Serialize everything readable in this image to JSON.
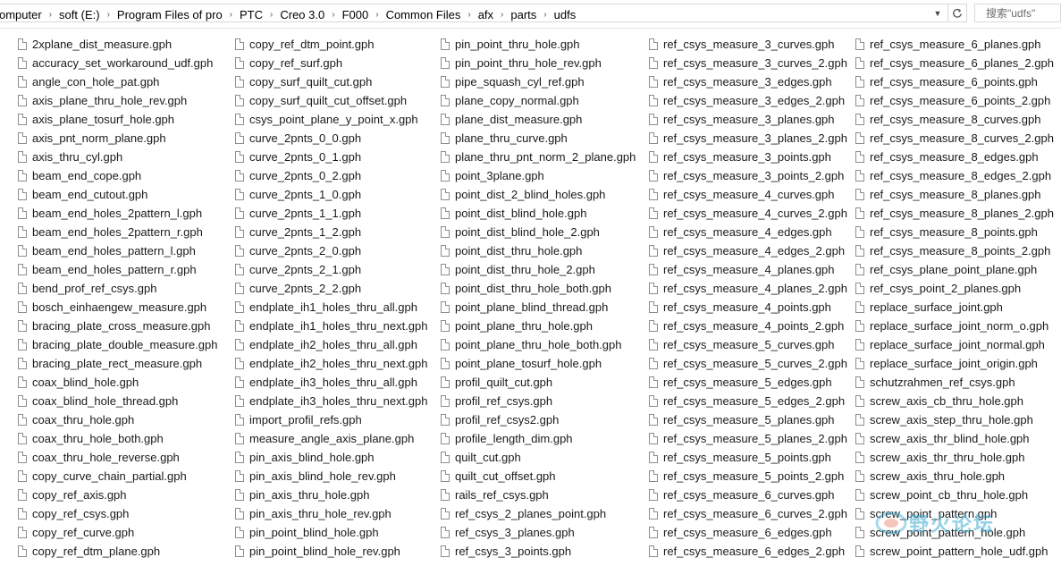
{
  "address_bar": {
    "crumbs": [
      "omputer",
      "soft (E:)",
      "Program Files of pro",
      "PTC",
      "Creo 3.0",
      "F000",
      "Common Files",
      "afx",
      "parts",
      "udfs"
    ]
  },
  "search": {
    "placeholder": "搜索\"udfs\""
  },
  "watermark": {
    "text": "野火论坛"
  },
  "files": [
    [
      "2xplane_dist_measure.gph",
      "accuracy_set_workaround_udf.gph",
      "angle_con_hole_pat.gph",
      "axis_plane_thru_hole_rev.gph",
      "axis_plane_tosurf_hole.gph",
      "axis_pnt_norm_plane.gph",
      "axis_thru_cyl.gph",
      "beam_end_cope.gph",
      "beam_end_cutout.gph",
      "beam_end_holes_2pattern_l.gph",
      "beam_end_holes_2pattern_r.gph",
      "beam_end_holes_pattern_l.gph",
      "beam_end_holes_pattern_r.gph",
      "bend_prof_ref_csys.gph",
      "bosch_einhaengew_measure.gph",
      "bracing_plate_cross_measure.gph",
      "bracing_plate_double_measure.gph",
      "bracing_plate_rect_measure.gph",
      "coax_blind_hole.gph",
      "coax_blind_hole_thread.gph",
      "coax_thru_hole.gph",
      "coax_thru_hole_both.gph",
      "coax_thru_hole_reverse.gph",
      "copy_curve_chain_partial.gph",
      "copy_ref_axis.gph",
      "copy_ref_csys.gph",
      "copy_ref_curve.gph",
      "copy_ref_dtm_plane.gph"
    ],
    [
      "copy_ref_dtm_point.gph",
      "copy_ref_surf.gph",
      "copy_surf_quilt_cut.gph",
      "copy_surf_quilt_cut_offset.gph",
      "csys_point_plane_y_point_x.gph",
      "curve_2pnts_0_0.gph",
      "curve_2pnts_0_1.gph",
      "curve_2pnts_0_2.gph",
      "curve_2pnts_1_0.gph",
      "curve_2pnts_1_1.gph",
      "curve_2pnts_1_2.gph",
      "curve_2pnts_2_0.gph",
      "curve_2pnts_2_1.gph",
      "curve_2pnts_2_2.gph",
      "endplate_ih1_holes_thru_all.gph",
      "endplate_ih1_holes_thru_next.gph",
      "endplate_ih2_holes_thru_all.gph",
      "endplate_ih2_holes_thru_next.gph",
      "endplate_ih3_holes_thru_all.gph",
      "endplate_ih3_holes_thru_next.gph",
      "import_profil_refs.gph",
      "measure_angle_axis_plane.gph",
      "pin_axis_blind_hole.gph",
      "pin_axis_blind_hole_rev.gph",
      "pin_axis_thru_hole.gph",
      "pin_axis_thru_hole_rev.gph",
      "pin_point_blind_hole.gph",
      "pin_point_blind_hole_rev.gph"
    ],
    [
      "pin_point_thru_hole.gph",
      "pin_point_thru_hole_rev.gph",
      "pipe_squash_cyl_ref.gph",
      "plane_copy_normal.gph",
      "plane_dist_measure.gph",
      "plane_thru_curve.gph",
      "plane_thru_pnt_norm_2_plane.gph",
      "point_3plane.gph",
      "point_dist_2_blind_holes.gph",
      "point_dist_blind_hole.gph",
      "point_dist_blind_hole_2.gph",
      "point_dist_thru_hole.gph",
      "point_dist_thru_hole_2.gph",
      "point_dist_thru_hole_both.gph",
      "point_plane_blind_thread.gph",
      "point_plane_thru_hole.gph",
      "point_plane_thru_hole_both.gph",
      "point_plane_tosurf_hole.gph",
      "profil_quilt_cut.gph",
      "profil_ref_csys.gph",
      "profil_ref_csys2.gph",
      "profile_length_dim.gph",
      "quilt_cut.gph",
      "quilt_cut_offset.gph",
      "rails_ref_csys.gph",
      "ref_csys_2_planes_point.gph",
      "ref_csys_3_planes.gph",
      "ref_csys_3_points.gph"
    ],
    [
      "ref_csys_measure_3_curves.gph",
      "ref_csys_measure_3_curves_2.gph",
      "ref_csys_measure_3_edges.gph",
      "ref_csys_measure_3_edges_2.gph",
      "ref_csys_measure_3_planes.gph",
      "ref_csys_measure_3_planes_2.gph",
      "ref_csys_measure_3_points.gph",
      "ref_csys_measure_3_points_2.gph",
      "ref_csys_measure_4_curves.gph",
      "ref_csys_measure_4_curves_2.gph",
      "ref_csys_measure_4_edges.gph",
      "ref_csys_measure_4_edges_2.gph",
      "ref_csys_measure_4_planes.gph",
      "ref_csys_measure_4_planes_2.gph",
      "ref_csys_measure_4_points.gph",
      "ref_csys_measure_4_points_2.gph",
      "ref_csys_measure_5_curves.gph",
      "ref_csys_measure_5_curves_2.gph",
      "ref_csys_measure_5_edges.gph",
      "ref_csys_measure_5_edges_2.gph",
      "ref_csys_measure_5_planes.gph",
      "ref_csys_measure_5_planes_2.gph",
      "ref_csys_measure_5_points.gph",
      "ref_csys_measure_5_points_2.gph",
      "ref_csys_measure_6_curves.gph",
      "ref_csys_measure_6_curves_2.gph",
      "ref_csys_measure_6_edges.gph",
      "ref_csys_measure_6_edges_2.gph"
    ],
    [
      "ref_csys_measure_6_planes.gph",
      "ref_csys_measure_6_planes_2.gph",
      "ref_csys_measure_6_points.gph",
      "ref_csys_measure_6_points_2.gph",
      "ref_csys_measure_8_curves.gph",
      "ref_csys_measure_8_curves_2.gph",
      "ref_csys_measure_8_edges.gph",
      "ref_csys_measure_8_edges_2.gph",
      "ref_csys_measure_8_planes.gph",
      "ref_csys_measure_8_planes_2.gph",
      "ref_csys_measure_8_points.gph",
      "ref_csys_measure_8_points_2.gph",
      "ref_csys_plane_point_plane.gph",
      "ref_csys_point_2_planes.gph",
      "replace_surface_joint.gph",
      "replace_surface_joint_norm_o.gph",
      "replace_surface_joint_normal.gph",
      "replace_surface_joint_origin.gph",
      "schutzrahmen_ref_csys.gph",
      "screw_axis_cb_thru_hole.gph",
      "screw_axis_step_thru_hole.gph",
      "screw_axis_thr_blind_hole.gph",
      "screw_axis_thr_thru_hole.gph",
      "screw_axis_thru_hole.gph",
      "screw_point_cb_thru_hole.gph",
      "screw_point_pattern.gph",
      "screw_point_pattern_hole.gph",
      "screw_point_pattern_hole_udf.gph"
    ]
  ]
}
